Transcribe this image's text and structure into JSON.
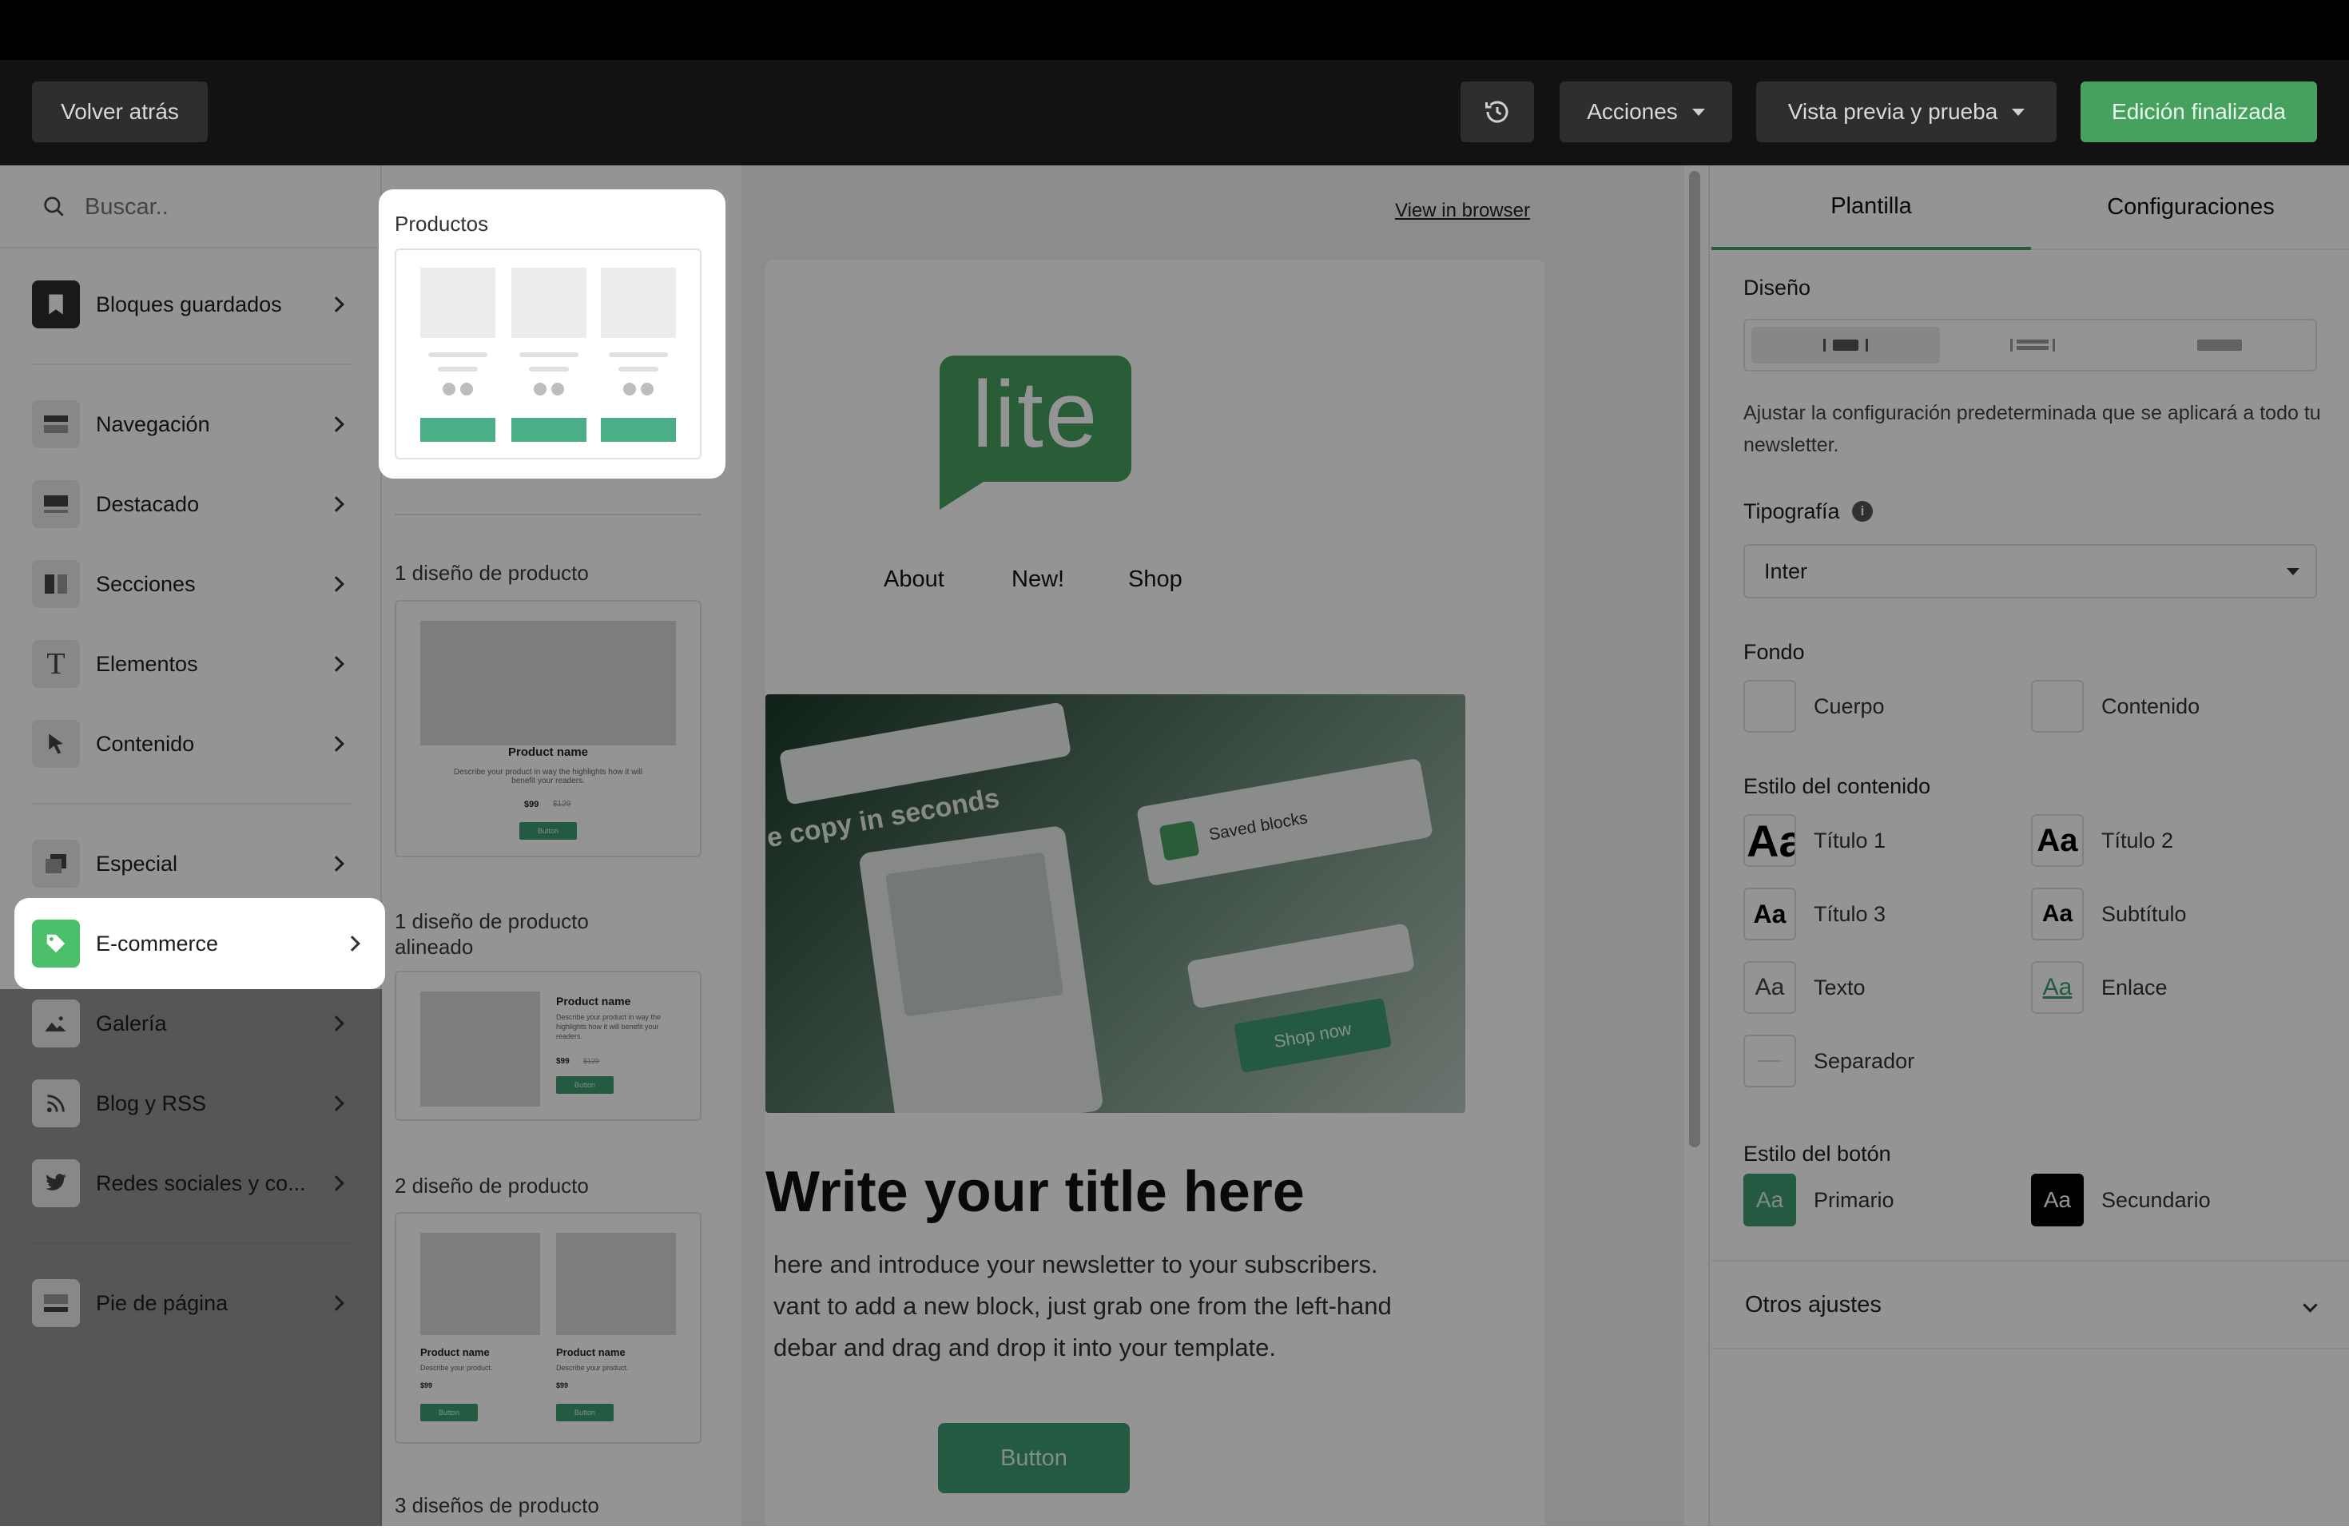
{
  "toolbar": {
    "back_label": "Volver atrás",
    "actions_label": "Acciones",
    "preview_label": "Vista previa y prueba",
    "done_label": "Edición finalizada",
    "history_icon": "history-icon"
  },
  "sidebar": {
    "search_placeholder": "Buscar..",
    "items": [
      {
        "label": "Bloques guardados",
        "icon": "bookmark-icon"
      },
      {
        "label": "Navegación",
        "icon": "navigation-icon"
      },
      {
        "label": "Destacado",
        "icon": "featured-icon"
      },
      {
        "label": "Secciones",
        "icon": "sections-icon"
      },
      {
        "label": "Elementos",
        "icon": "text-icon"
      },
      {
        "label": "Contenido",
        "icon": "cursor-icon"
      },
      {
        "label": "Especial",
        "icon": "special-icon"
      },
      {
        "label": "E-commerce",
        "icon": "tag-icon"
      },
      {
        "label": "Galería",
        "icon": "image-icon"
      },
      {
        "label": "Blog y RSS",
        "icon": "rss-icon"
      },
      {
        "label": "Redes sociales y co...",
        "icon": "twitter-icon"
      },
      {
        "label": "Pie de página",
        "icon": "footer-icon"
      }
    ]
  },
  "blocks": {
    "highlight_title": "Productos",
    "sections": [
      {
        "label": "1 diseño de producto"
      },
      {
        "label": "1 diseño de producto alineado"
      },
      {
        "label": "2 diseño de producto"
      },
      {
        "label": "3 diseños de producto"
      }
    ],
    "product_name": "Product name",
    "product_desc_long": "Describe your product in way the highlights how it will benefit your readers.",
    "product_desc_short": "Describe your product.",
    "price": "$99",
    "old_price": "$129",
    "button": "Button"
  },
  "canvas": {
    "view_in_browser": "View in browser",
    "logo_text": "lite",
    "nav": [
      "About",
      "New!",
      "Shop"
    ],
    "hero": {
      "copy_text": "e copy in seconds",
      "saved_blocks": "Saved blocks",
      "shop_now": "Shop now"
    },
    "title": "Write your title here",
    "body_lines": [
      "here and introduce your newsletter to your subscribers.",
      "vant to add a new block, just grab one from the left-hand",
      "debar and drag and drop it into your template."
    ],
    "button_label": "Button"
  },
  "right": {
    "tabs": [
      {
        "label": "Plantilla",
        "active": true
      },
      {
        "label": "Configuraciones",
        "active": false
      }
    ],
    "design_title": "Diseño",
    "design_desc": "Ajustar la configuración predeterminada que se aplicará a todo tu newsletter.",
    "typography_title": "Tipografía",
    "typography_value": "Inter",
    "background_title": "Fondo",
    "background_items": [
      "Cuerpo",
      "Contenido"
    ],
    "content_style_title": "Estilo del contenido",
    "content_styles": [
      {
        "swatch": "Aa",
        "label": "Título 1"
      },
      {
        "swatch": "Aa",
        "label": "Título 2"
      },
      {
        "swatch": "Aa",
        "label": "Título 3"
      },
      {
        "swatch": "Aa",
        "label": "Subtítulo"
      },
      {
        "swatch": "Aa",
        "label": "Texto"
      },
      {
        "swatch": "Aa",
        "label": "Enlace"
      },
      {
        "swatch": "",
        "label": "Separador"
      }
    ],
    "button_style_title": "Estilo del botón",
    "button_styles": [
      {
        "swatch": "Aa",
        "label": "Primario"
      },
      {
        "swatch": "Aa",
        "label": "Secundario"
      }
    ],
    "other_settings": "Otros ajustes"
  },
  "colors": {
    "brand_green": "#47a05f",
    "button_green": "#3f9a72",
    "dark": "#121212",
    "overlay": "rgba(0,0,0,0.42)"
  }
}
